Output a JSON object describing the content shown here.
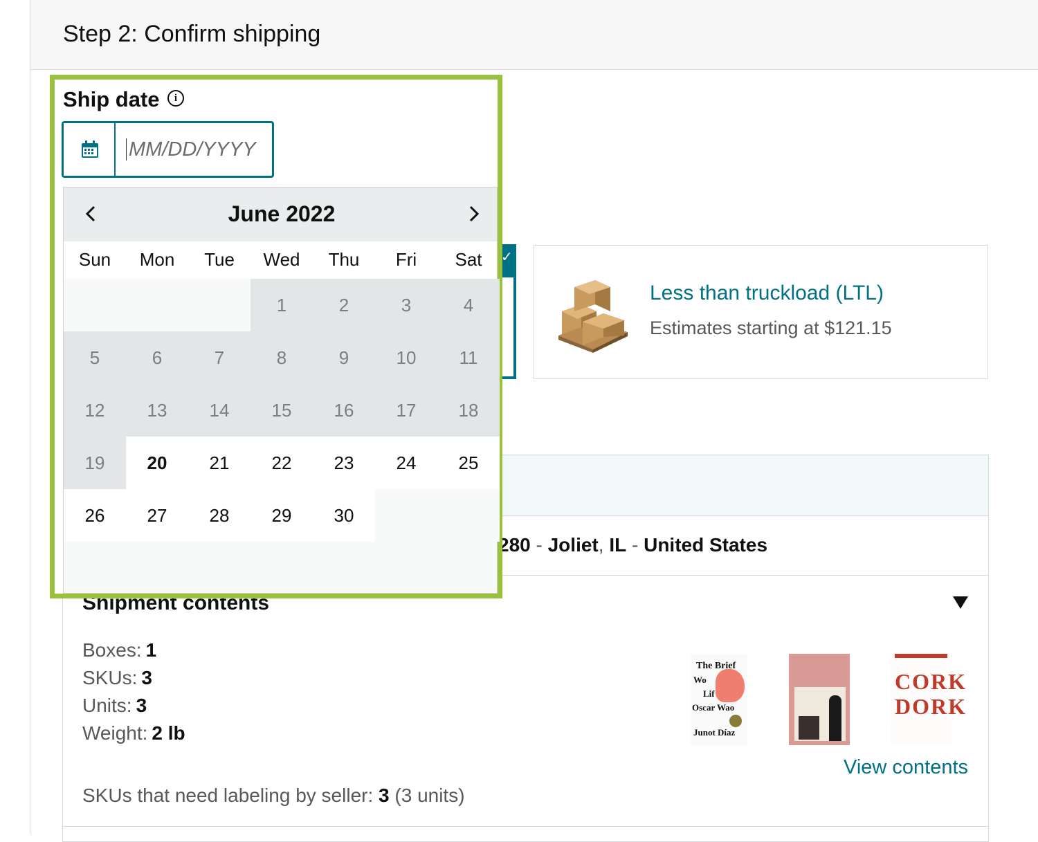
{
  "step_title": "Step 2: Confirm shipping",
  "ship_date": {
    "label": "Ship date",
    "info_icon": "info-icon",
    "input_placeholder": "MM/DD/YYYY",
    "calendar_icon": "calendar-icon"
  },
  "calendar": {
    "month_label": "June 2022",
    "weekdays": [
      "Sun",
      "Mon",
      "Tue",
      "Wed",
      "Thu",
      "Fri",
      "Sat"
    ],
    "first_weekday_index": 3,
    "days_in_month": 30,
    "first_available_day": 20,
    "today": 20,
    "prev_icon": "chevron-left-icon",
    "next_icon": "chevron-right-icon"
  },
  "ltl_option": {
    "title": "Less than truckload (LTL)",
    "subtitle": "Estimates starting at $121.15",
    "icon": "pallet-icon",
    "selected_icon": "checkmark-icon"
  },
  "ship_from": {
    "partial_zip": "280",
    "city": "Joliet",
    "state": "IL",
    "country": "United States"
  },
  "shipment_contents": {
    "title": "Shipment contents",
    "boxes_label": "Boxes:",
    "boxes": "1",
    "skus_label": "SKUs:",
    "skus": "3",
    "units_label": "Units:",
    "units": "3",
    "weight_label": "Weight:",
    "weight": "2 lb",
    "labeling_label": "SKUs that need labeling by seller:",
    "labeling_count": "3",
    "labeling_units": "(3 units)",
    "view_contents": "View contents",
    "toggle_icon": "caret-down-icon",
    "books": [
      {
        "title_lines": [
          "The Brief",
          "Wo",
          "Lif",
          "Oscar Wao"
        ],
        "author": "Junot Díaz"
      },
      {
        "title_lines": [],
        "author": ""
      },
      {
        "title_lines": [
          "CORK",
          "DORK"
        ],
        "author": ""
      }
    ]
  },
  "colors": {
    "accent": "#007185",
    "highlight": "#99c13e",
    "disabled_day": "#e3e6e6"
  }
}
